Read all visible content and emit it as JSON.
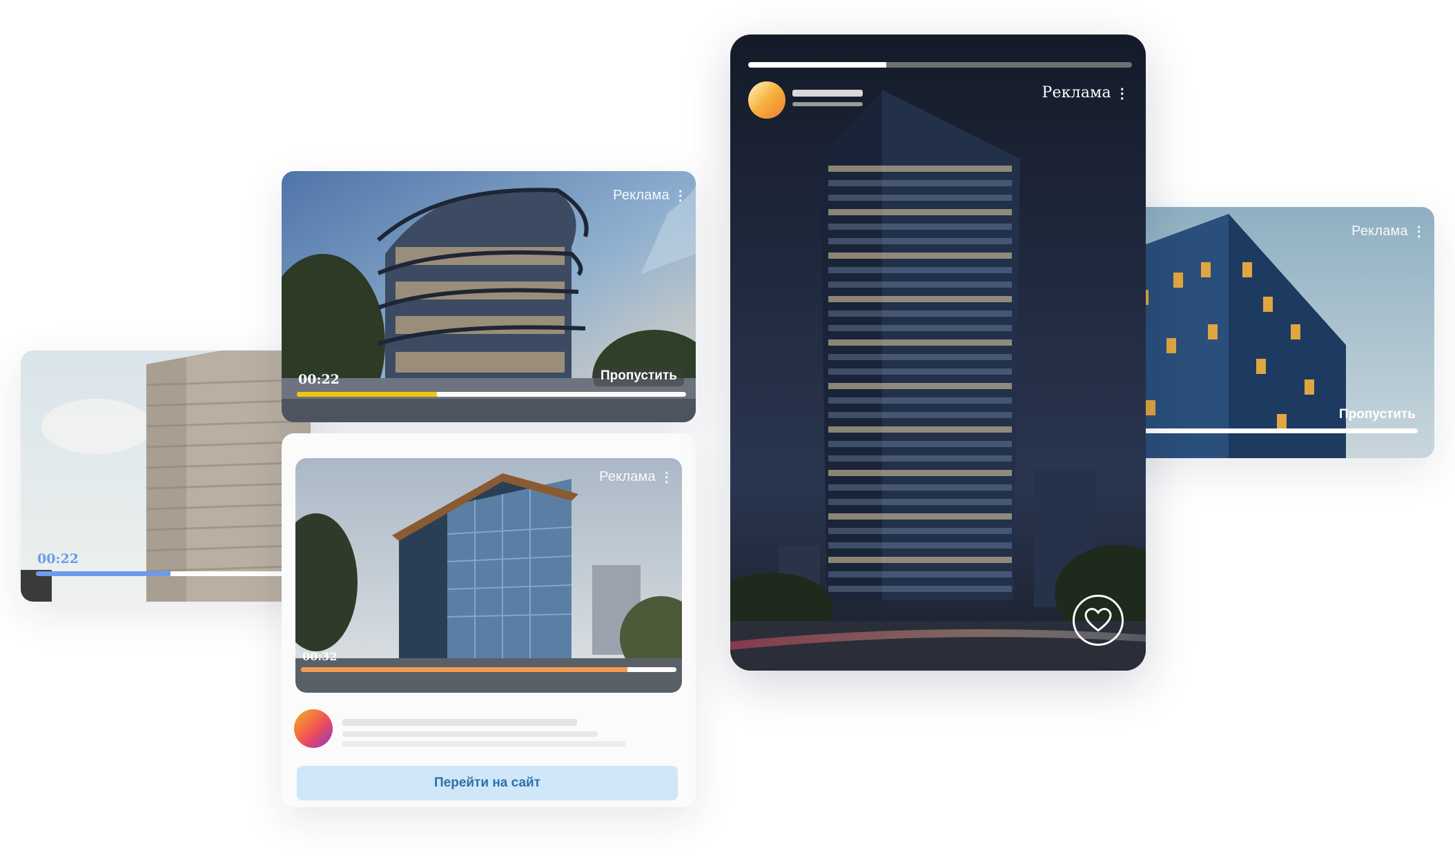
{
  "ad_label": "Реклама",
  "colors": {
    "yellow": "#f2c510",
    "blue": "#6d9bea",
    "orange": "#f39a52",
    "cta_bg": "#cfe7f9",
    "cta_text": "#2f6faa"
  },
  "card_left": {
    "time": "00:22",
    "progress": 0.49
  },
  "card_top": {
    "time": "00:22",
    "skip_label": "Пропустить",
    "progress": 0.36
  },
  "card_feed": {
    "time": "00:32",
    "progress": 0.87,
    "cta_label": "Перейти на сайт"
  },
  "card_story": {
    "progress": 0.36,
    "like_icon": "heart-icon"
  },
  "card_right": {
    "skip_label": "Пропустить",
    "progress": 0.09
  }
}
